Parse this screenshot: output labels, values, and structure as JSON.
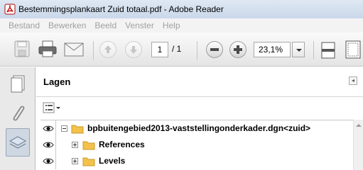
{
  "window": {
    "title": "Bestemmingsplankaart Zuid totaal.pdf - Adobe Reader"
  },
  "menu": [
    "Bestand",
    "Bewerken",
    "Beeld",
    "Venster",
    "Help"
  ],
  "toolbar": {
    "page_current": "1",
    "page_total": "/ 1",
    "zoom": "23,1%"
  },
  "nav_pane": {
    "items": [
      "page-thumbnails",
      "attachments",
      "layers"
    ],
    "active": "layers"
  },
  "layers_panel": {
    "title": "Lagen",
    "tree": [
      {
        "label": "bpbuitengebied2013-vaststellingonderkader.dgn<zuid>",
        "level": 0,
        "expanded": true,
        "visible": true
      },
      {
        "label": "References",
        "level": 1,
        "expanded": false,
        "visible": true
      },
      {
        "label": "Levels",
        "level": 1,
        "expanded": false,
        "visible": true
      }
    ]
  },
  "colors": {
    "titlebar": "#c9d8ea",
    "folder": "#f3c24a",
    "menu_disabled": "#a0a0a0"
  }
}
